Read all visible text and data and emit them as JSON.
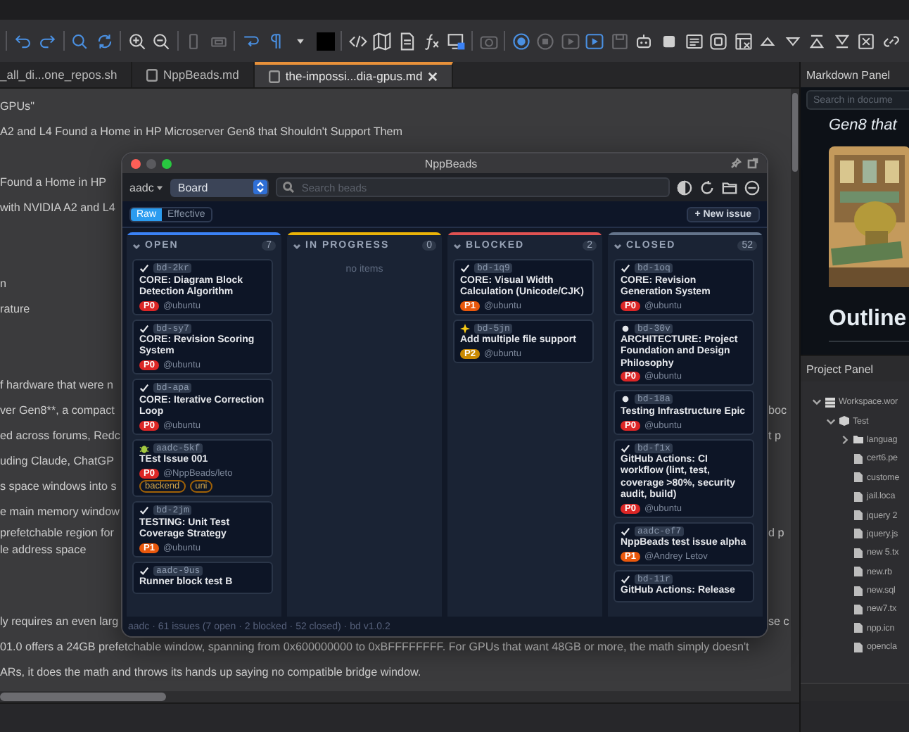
{
  "tabs": [
    {
      "label": "_all_di...one_repos.sh",
      "selected": false
    },
    {
      "label": "NppBeads.md",
      "selected": false
    },
    {
      "label": "the-impossi...dia-gpus.md",
      "selected": true
    }
  ],
  "editor": {
    "lines": [
      {
        "kind": "line",
        "text": "GPUs\""
      },
      {
        "kind": "line",
        "text": "A2 and L4 Found a Home in HP Microserver Gen8 that Shouldn't Support Them"
      },
      {
        "kind": "blank"
      },
      {
        "kind": "line",
        "text": "Found a Home in HP"
      },
      {
        "kind": "line",
        "text": "with NVIDIA A2 and L4"
      },
      {
        "kind": "blank"
      },
      {
        "kind": "blank"
      },
      {
        "kind": "line",
        "text": "n"
      },
      {
        "kind": "line",
        "text": "rature"
      },
      {
        "kind": "blank"
      },
      {
        "kind": "blank"
      },
      {
        "kind": "line",
        "text": "f hardware that were n"
      },
      {
        "kind": "line",
        "text": "ver Gen8**, a compact",
        "right": "boc"
      },
      {
        "kind": "line",
        "text": "ed across forums, Redc",
        "right": "t p"
      },
      {
        "kind": "line",
        "text": "uding Claude, ChatGP"
      },
      {
        "kind": "line",
        "text": "s space windows into s"
      },
      {
        "kind": "line",
        "text": "e main memory window"
      },
      {
        "kind": "wrap",
        "text": "prefetchable region for",
        "right": "d p"
      },
      {
        "kind": "wrap",
        "text": "le address space"
      },
      {
        "kind": "blank"
      },
      {
        "kind": "blank"
      },
      {
        "kind": "line",
        "text": "ly requires an even larg",
        "right": "se c"
      },
      {
        "kind": "line",
        "text": "01.0 offers a 24GB prefetchable window, spanning from 0x600000000 to 0xBFFFFFFFF. For GPUs that want 48GB or more, the math simply doesn't"
      },
      {
        "kind": "line",
        "text": "ARs, it does the math and throws its hands up saying no compatible bridge window."
      }
    ]
  },
  "markdown_panel": {
    "title": "Markdown Panel",
    "search": {
      "placeholder": "Search in docume"
    },
    "content": [
      {
        "kind": "emphasis",
        "text": "Gen8 that"
      },
      {
        "kind": "picture"
      },
      {
        "kind": "heading",
        "text": "Outline"
      }
    ]
  },
  "project_panel": {
    "title": "Project Panel",
    "tree": [
      {
        "label": "Workspace.wor",
        "kind": "workspace",
        "expanded": true,
        "children": [
          {
            "label": "Test",
            "kind": "project",
            "expanded": true,
            "children": [
              {
                "label": "languag",
                "kind": "folder",
                "expanded": false
              },
              {
                "label": "cert6.pe",
                "kind": "file"
              },
              {
                "label": "custome",
                "kind": "file"
              },
              {
                "label": "jail.loca",
                "kind": "file"
              },
              {
                "label": "jquery 2",
                "kind": "file"
              },
              {
                "label": "jquery.js",
                "kind": "file"
              },
              {
                "label": "new 5.tx",
                "kind": "file"
              },
              {
                "label": "new.rb",
                "kind": "file"
              },
              {
                "label": "new.sql",
                "kind": "file"
              },
              {
                "label": "new7.tx",
                "kind": "file"
              },
              {
                "label": "npp.icn",
                "kind": "file"
              },
              {
                "label": "opencla",
                "kind": "file"
              }
            ]
          }
        ]
      }
    ]
  },
  "beads": {
    "title": "NppBeads",
    "workspace": "aadc",
    "view": "Board",
    "search": {
      "placeholder": "Search beads"
    },
    "modes": [
      {
        "label": "Raw",
        "selected": true
      },
      {
        "label": "Effective",
        "selected": false
      }
    ],
    "new_button": "+ New issue",
    "columns": [
      {
        "title": "OPEN",
        "count": "7",
        "color": "#3b82f6",
        "cards": [
          {
            "kind": "task",
            "id": "bd-2kr",
            "title": "CORE: Diagram Block Detection Algorithm",
            "priority": {
              "label": "P0",
              "color": "#dc2626"
            },
            "assignee": "@ubuntu"
          },
          {
            "kind": "task",
            "id": "bd-sy7",
            "title": "CORE: Revision Scoring System",
            "priority": {
              "label": "P0",
              "color": "#dc2626"
            },
            "assignee": "@ubuntu"
          },
          {
            "kind": "task",
            "id": "bd-apa",
            "title": "CORE: Iterative Correction Loop",
            "priority": {
              "label": "P0",
              "color": "#dc2626"
            },
            "assignee": "@ubuntu"
          },
          {
            "kind": "bug",
            "id": "aadc-5kf",
            "title": "TEst Issue 001",
            "priority": {
              "label": "P0",
              "color": "#dc2626"
            },
            "assignee": "@NppBeads/leto",
            "labels": [
              "backend",
              "uni"
            ]
          },
          {
            "kind": "task",
            "id": "bd-2jm",
            "title": "TESTING: Unit Test Coverage Strategy",
            "priority": {
              "label": "P1",
              "color": "#ea580c"
            },
            "assignee": "@ubuntu"
          },
          {
            "kind": "task",
            "id": "aadc-9us",
            "title": "Runner block test B"
          }
        ]
      },
      {
        "title": "IN PROGRESS",
        "count": "0",
        "color": "#eab308",
        "empty_text": "no items"
      },
      {
        "title": "BLOCKED",
        "count": "2",
        "color": "#e05252",
        "cards": [
          {
            "kind": "task",
            "id": "bd-1q9",
            "title": "CORE: Visual Width Calculation (Unicode/CJK)",
            "priority": {
              "label": "P1",
              "color": "#ea580c"
            },
            "assignee": "@ubuntu"
          },
          {
            "kind": "feature",
            "id": "bd-5jn",
            "title": "Add multiple file support",
            "priority": {
              "label": "P2",
              "color": "#ca8a04"
            },
            "assignee": "@ubuntu"
          }
        ]
      },
      {
        "title": "CLOSED",
        "count": "52",
        "color": "#64748b",
        "cards": [
          {
            "kind": "task",
            "id": "bd-1oq",
            "title": "CORE: Revision Generation System",
            "priority": {
              "label": "P0",
              "color": "#dc2626"
            },
            "assignee": "@ubuntu"
          },
          {
            "kind": "epic",
            "id": "bd-30v",
            "title": "ARCHITECTURE: Project Foundation and Design Philosophy",
            "priority": {
              "label": "P0",
              "color": "#dc2626"
            },
            "assignee": "@ubuntu"
          },
          {
            "kind": "epic",
            "id": "bd-18a",
            "title": "Testing Infrastructure Epic",
            "priority": {
              "label": "P0",
              "color": "#dc2626"
            },
            "assignee": "@ubuntu"
          },
          {
            "kind": "task",
            "id": "bd-f1x",
            "title": "GitHub Actions: CI workflow (lint, test, coverage >80%, security audit, build)",
            "priority": {
              "label": "P0",
              "color": "#dc2626"
            },
            "assignee": "@ubuntu"
          },
          {
            "kind": "task",
            "id": "aadc-ef7",
            "title": "NppBeads test issue alpha",
            "priority": {
              "label": "P1",
              "color": "#ea580c"
            },
            "assignee": "@Andrey Letov"
          },
          {
            "kind": "task",
            "id": "bd-11r",
            "title": "GitHub Actions: Release"
          }
        ]
      }
    ],
    "status": "aadc · 61 issues (7 open · 2 blocked · 52 closed) · bd v1.0.2"
  }
}
